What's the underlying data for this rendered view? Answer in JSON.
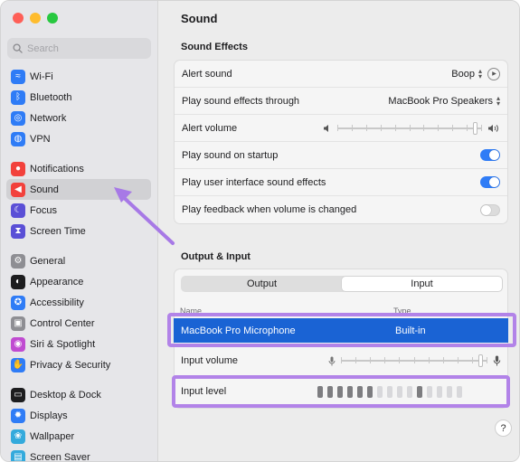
{
  "window": {
    "title": "Sound"
  },
  "sidebar": {
    "search_placeholder": "Search",
    "groups": [
      [
        {
          "label": "Wi-Fi",
          "icon": "wifi-icon",
          "color": "#2f7cf6",
          "glyph": "≈"
        },
        {
          "label": "Bluetooth",
          "icon": "bluetooth-icon",
          "color": "#2f7cf6",
          "glyph": "ᛒ"
        },
        {
          "label": "Network",
          "icon": "globe-icon",
          "color": "#2f7cf6",
          "glyph": "◎"
        },
        {
          "label": "VPN",
          "icon": "vpn-icon",
          "color": "#2f7cf6",
          "glyph": "◍"
        }
      ],
      [
        {
          "label": "Notifications",
          "icon": "bell-icon",
          "color": "#f2413c",
          "glyph": "●"
        },
        {
          "label": "Sound",
          "icon": "speaker-icon",
          "color": "#f2413c",
          "glyph": "◀",
          "active": true
        },
        {
          "label": "Focus",
          "icon": "moon-icon",
          "color": "#5a4fd6",
          "glyph": "☾"
        },
        {
          "label": "Screen Time",
          "icon": "hourglass-icon",
          "color": "#5a4fd6",
          "glyph": "⧗"
        }
      ],
      [
        {
          "label": "General",
          "icon": "gear-icon",
          "color": "#8e8e93",
          "glyph": "⚙"
        },
        {
          "label": "Appearance",
          "icon": "appearance-icon",
          "color": "#1d1d1f",
          "glyph": "◐"
        },
        {
          "label": "Accessibility",
          "icon": "accessibility-icon",
          "color": "#2f7cf6",
          "glyph": "✪"
        },
        {
          "label": "Control Center",
          "icon": "control-center-icon",
          "color": "#8e8e93",
          "glyph": "▣"
        },
        {
          "label": "Siri & Spotlight",
          "icon": "siri-icon",
          "color": "#c04bd1",
          "glyph": "◉"
        },
        {
          "label": "Privacy & Security",
          "icon": "hand-icon",
          "color": "#2f7cf6",
          "glyph": "✋"
        }
      ],
      [
        {
          "label": "Desktop & Dock",
          "icon": "dock-icon",
          "color": "#1d1d1f",
          "glyph": "▭"
        },
        {
          "label": "Displays",
          "icon": "displays-icon",
          "color": "#2f7cf6",
          "glyph": "✹"
        },
        {
          "label": "Wallpaper",
          "icon": "wallpaper-icon",
          "color": "#34aadc",
          "glyph": "❀"
        },
        {
          "label": "Screen Saver",
          "icon": "screensaver-icon",
          "color": "#34aadc",
          "glyph": "▤"
        }
      ]
    ]
  },
  "main": {
    "title": "Sound",
    "sound_effects": {
      "heading": "Sound Effects",
      "alert_sound": {
        "label": "Alert sound",
        "value": "Boop"
      },
      "play_through": {
        "label": "Play sound effects through",
        "value": "MacBook Pro Speakers"
      },
      "alert_volume": {
        "label": "Alert volume",
        "level": 0.97
      },
      "startup": {
        "label": "Play sound on startup",
        "on": true
      },
      "ui_effects": {
        "label": "Play user interface sound effects",
        "on": true
      },
      "feedback": {
        "label": "Play feedback when volume is changed",
        "on": false
      }
    },
    "output_input": {
      "heading": "Output & Input",
      "tabs": [
        "Output",
        "Input"
      ],
      "active_tab": 1,
      "columns": {
        "name": "Name",
        "type": "Type"
      },
      "device": {
        "name": "MacBook Pro Microphone",
        "type": "Built-in"
      },
      "input_volume": {
        "label": "Input volume",
        "level": 0.97
      },
      "input_level": {
        "label": "Input level",
        "bars_total": 15,
        "bars_lit": 6,
        "extra_lit": [
          10
        ]
      }
    },
    "help_label": "?"
  },
  "colors": {
    "accent": "#2f7cf6",
    "selection": "#1a63d4",
    "highlight": "#b283e8"
  }
}
